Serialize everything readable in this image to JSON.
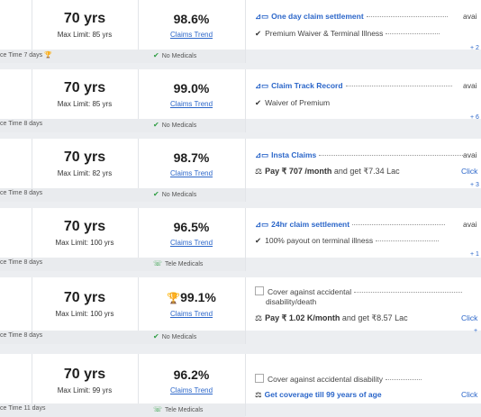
{
  "rows": [
    {
      "age": "70 yrs",
      "max_limit": "Max Limit: 85 yrs",
      "claim_pct": "98.6%",
      "trend": "Claims Trend",
      "claim_time": "ce Time 7 days",
      "medical": "No Medicals",
      "feature_1": "One day claim settlement",
      "feature_1_tail": "avai",
      "feature_2": "Premium Waiver & Terminal Illness",
      "more": "+ 2"
    },
    {
      "age": "70 yrs",
      "max_limit": "Max Limit: 85 yrs",
      "claim_pct": "99.0%",
      "trend": "Claims Trend",
      "claim_time": "ce Time 8 days",
      "medical": "No Medicals",
      "feature_1": "Claim Track Record",
      "feature_1_tail": "avai",
      "feature_2": "Waiver of Premium",
      "more": "+ 6"
    },
    {
      "age": "70 yrs",
      "max_limit": "Max Limit: 82 yrs",
      "claim_pct": "98.7%",
      "trend": "Claims Trend",
      "claim_time": "ce Time 8 days",
      "medical": "No Medicals",
      "feature_1": "Insta Claims",
      "feature_1_tail": "avai",
      "pay_prefix": "Pay",
      "pay_amount": "₹ 707 /month",
      "pay_mid": "and get",
      "pay_cover": "₹7.34 Lac",
      "click": "Click",
      "more": "+ 3"
    },
    {
      "age": "70 yrs",
      "max_limit": "Max Limit: 100 yrs",
      "claim_pct": "96.5%",
      "trend": "Claims Trend",
      "claim_time": "ce Time 8 days",
      "medical": "Tele Medicals",
      "feature_1": "24hr claim settlement",
      "feature_1_tail": "avai",
      "feature_2": "100% payout on terminal illness",
      "more": "+ 1"
    },
    {
      "age": "70 yrs",
      "max_limit": "Max Limit: 100 yrs",
      "claim_pct": "99.1%",
      "trend": "Claims Trend",
      "claim_time": "ce Time 8 days",
      "medical": "No Medicals",
      "feature_1a": "Cover against accidental",
      "feature_1b": "disability/death",
      "pay_prefix": "Pay",
      "pay_amount": "₹ 1.02 K/month",
      "pay_mid": "and get",
      "pay_cover": "₹8.57 Lac",
      "click": "Click",
      "more": "+"
    },
    {
      "age": "70 yrs",
      "max_limit": "Max Limit: 99 yrs",
      "claim_pct": "96.2%",
      "trend": "Claims Trend",
      "claim_time": "ce Time 11 days",
      "medical": "Tele Medicals",
      "feature_1": "Cover against accidental disability",
      "feature_2": "Get coverage till 99 years of age",
      "click": "Click"
    }
  ]
}
